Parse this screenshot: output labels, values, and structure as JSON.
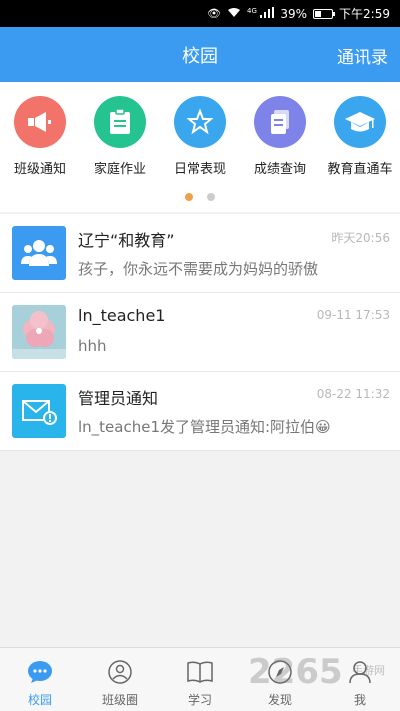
{
  "status_bar": {
    "battery": "39%",
    "battery_level": 0.39,
    "time": "下午2:59",
    "signal_label": "4G"
  },
  "header": {
    "title": "校园",
    "contacts_label": "通讯录"
  },
  "shortcuts": [
    {
      "label": "班级通知",
      "icon": "megaphone-icon",
      "color": "#f2736a"
    },
    {
      "label": "家庭作业",
      "icon": "clipboard-icon",
      "color": "#25c38f"
    },
    {
      "label": "日常表现",
      "icon": "star-icon",
      "color": "#3aa6ee"
    },
    {
      "label": "成绩查询",
      "icon": "document-icon",
      "color": "#7e83ea"
    },
    {
      "label": "教育直通车",
      "icon": "graduation-cap-icon",
      "color": "#3aa6ee"
    }
  ],
  "pager": {
    "count": 2,
    "active": 0
  },
  "messages": [
    {
      "name": "辽宁“和教育”",
      "time": "昨天20:56",
      "preview": "孩子，你永远不需要成为妈妈的骄傲",
      "icon": "group-icon",
      "color": "#3a9bf0"
    },
    {
      "name": "ln_teache1",
      "time": "09-11 17:53",
      "preview": "hhh",
      "icon": "flower-photo-avatar"
    },
    {
      "name": "管理员通知",
      "time": "08-22 11:32",
      "preview": "ln_teache1发了管理员通知:阿拉伯😀",
      "icon": "mail-alert-icon",
      "color": "#29b5ec"
    }
  ],
  "tabs": [
    {
      "label": "校园",
      "icon": "chat-bubble-icon",
      "active": true
    },
    {
      "label": "班级圈",
      "icon": "people-icon",
      "active": false
    },
    {
      "label": "学习",
      "icon": "book-icon",
      "active": false
    },
    {
      "label": "发现",
      "icon": "compass-icon",
      "active": false
    },
    {
      "label": "我",
      "icon": "person-icon",
      "active": false
    }
  ],
  "watermark": {
    "text": "2265",
    "sub": "手游网"
  }
}
